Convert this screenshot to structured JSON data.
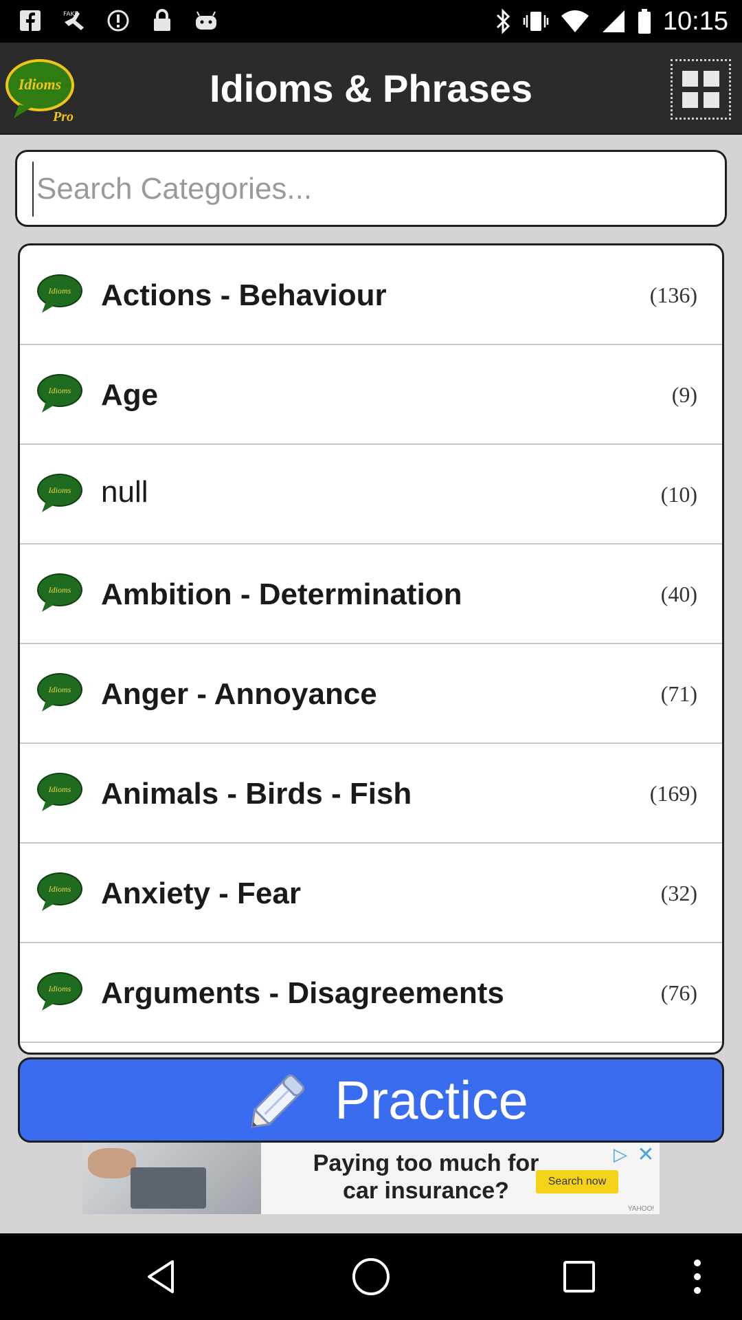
{
  "status_bar": {
    "time": "10:15",
    "left_icons": [
      "facebook-icon",
      "fake-gps-icon",
      "alert-icon",
      "lock-icon",
      "android-icon"
    ],
    "right_icons": [
      "bluetooth-icon",
      "vibrate-icon",
      "wifi-icon",
      "signal-icon",
      "battery-icon"
    ]
  },
  "header": {
    "logo_text": "Idioms",
    "logo_sub": "Pro",
    "title": "Idioms & Phrases"
  },
  "search": {
    "placeholder": "Search Categories...",
    "value": ""
  },
  "categories": [
    {
      "label": "Actions - Behaviour",
      "count": "(136)"
    },
    {
      "label": "Age",
      "count": "(9)"
    },
    {
      "label": "null",
      "count": "(10)"
    },
    {
      "label": "Ambition - Determination",
      "count": "(40)"
    },
    {
      "label": "Anger - Annoyance",
      "count": "(71)"
    },
    {
      "label": "Animals - Birds - Fish",
      "count": "(169)"
    },
    {
      "label": "Anxiety - Fear",
      "count": "(32)"
    },
    {
      "label": "Arguments - Disagreements",
      "count": "(76)"
    }
  ],
  "bubble_text": "Idioms",
  "practice": {
    "label": "Practice"
  },
  "ad": {
    "text_line1": "Paying too much for",
    "text_line2": "car insurance?",
    "cta": "Search now",
    "brand": "YAHOO!"
  },
  "colors": {
    "header_bg": "#2b2b2b",
    "main_bg": "#d4d4d4",
    "accent_blue": "#3a6cf0",
    "bubble_green": "#1f6b1f"
  }
}
